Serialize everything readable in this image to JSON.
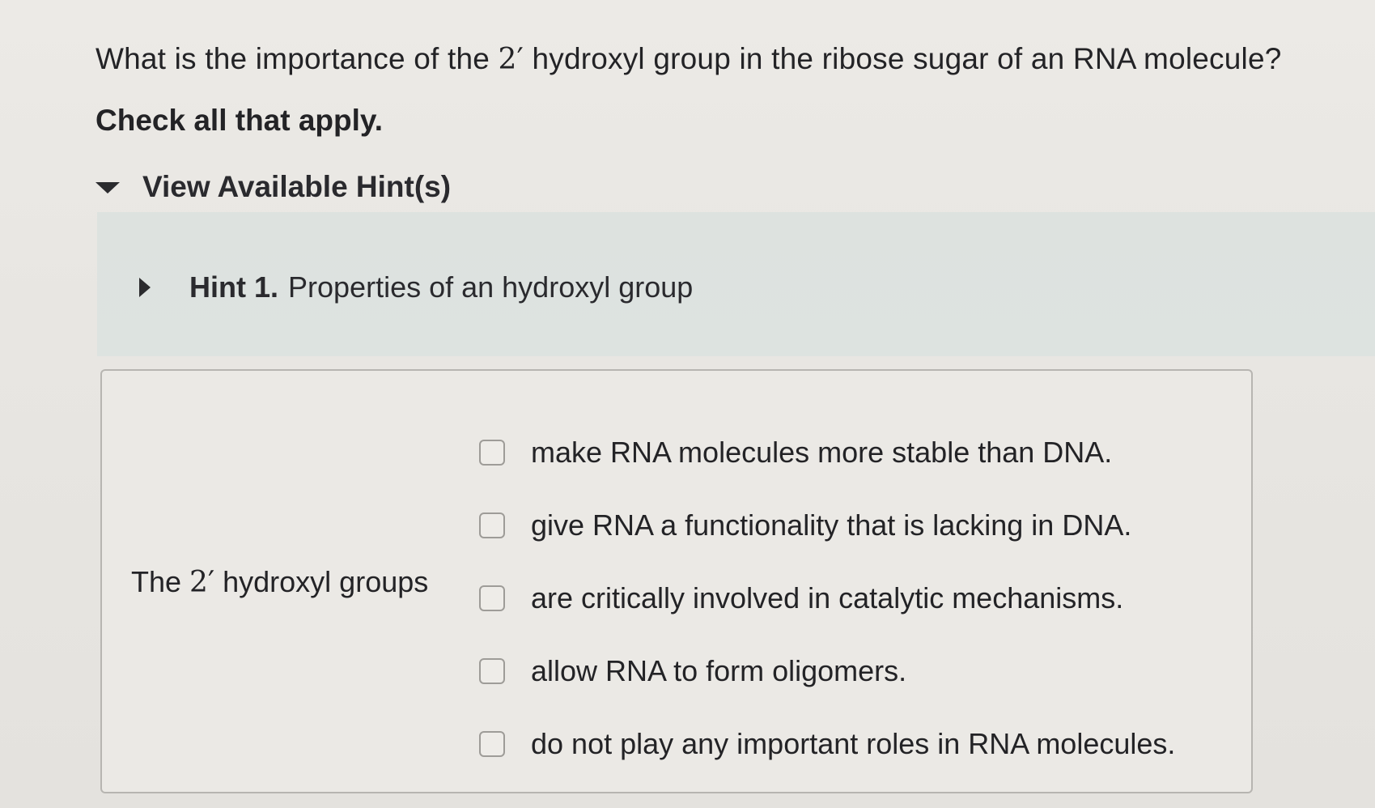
{
  "question": {
    "text_before": "What is the importance of the ",
    "math": "2′",
    "text_after": " hydroxyl group in the ribose sugar of an RNA molecule?",
    "instruction": "Check all that apply."
  },
  "hints": {
    "toggle_label": "View Available Hint(s)",
    "items": [
      {
        "number": "Hint 1.",
        "title": "Properties of an hydroxyl group"
      }
    ]
  },
  "answer": {
    "stem_before": "The ",
    "stem_math": "2′",
    "stem_after": " hydroxyl groups",
    "options": [
      {
        "label": "make RNA molecules more stable than DNA.",
        "checked": false
      },
      {
        "label": "give RNA a functionality that is lacking in DNA.",
        "checked": false
      },
      {
        "label": "are critically involved in catalytic mechanisms.",
        "checked": false
      },
      {
        "label": "allow RNA to form oligomers.",
        "checked": false
      },
      {
        "label": "do not play any important roles in RNA molecules.",
        "checked": false
      }
    ]
  }
}
